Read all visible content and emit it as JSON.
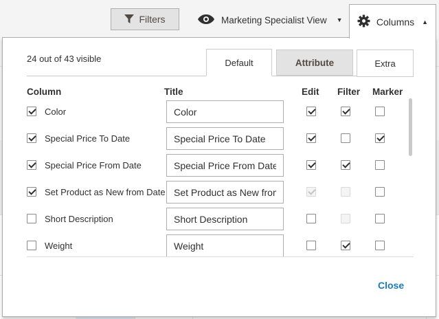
{
  "header": {
    "filters_label": "Filters",
    "view_label": "Marketing Specialist View",
    "columns_label": "Columns"
  },
  "panel": {
    "visible_count": "24 out of 43 visible",
    "tabs": [
      {
        "label": "Default",
        "active": true
      },
      {
        "label": "Attribute",
        "active": false
      },
      {
        "label": "Extra",
        "active": false
      }
    ],
    "headers": {
      "column": "Column",
      "title": "Title",
      "edit": "Edit",
      "filter": "Filter",
      "marker": "Marker"
    },
    "rows": [
      {
        "label": "Color",
        "visible": true,
        "title": "Color",
        "edit": true,
        "filter": true,
        "marker": false,
        "edit_disabled": false,
        "filter_disabled": false
      },
      {
        "label": "Special Price To Date",
        "visible": true,
        "title": "Special Price To Date",
        "edit": true,
        "filter": false,
        "marker": true,
        "edit_disabled": false,
        "filter_disabled": false
      },
      {
        "label": "Special Price From Date",
        "visible": true,
        "title": "Special Price From Date",
        "edit": true,
        "filter": true,
        "marker": false,
        "edit_disabled": false,
        "filter_disabled": false
      },
      {
        "label": "Set Product as New from Date",
        "visible": true,
        "title": "Set Product as New from Date",
        "edit": true,
        "filter": false,
        "marker": false,
        "edit_disabled": true,
        "filter_disabled": true
      },
      {
        "label": "Short Description",
        "visible": false,
        "title": "Short Description",
        "edit": false,
        "filter": false,
        "marker": false,
        "edit_disabled": false,
        "filter_disabled": true
      },
      {
        "label": "Weight",
        "visible": false,
        "title": "Weight",
        "edit": false,
        "filter": true,
        "marker": false,
        "edit_disabled": false,
        "filter_disabled": false
      }
    ],
    "close_label": "Close"
  }
}
